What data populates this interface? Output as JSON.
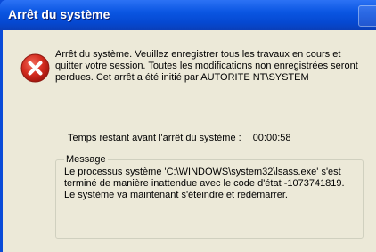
{
  "window": {
    "title": "Arrêt du système"
  },
  "dialog": {
    "icon": "error-icon",
    "message": "Arrêt du système. Veuillez enregistrer tous les travaux en cours et quitter votre session. Toutes les modifications non enregistrées seront perdues. Cet arrêt a été initié par AUTORITE NT\\SYSTEM",
    "countdown_label": "Temps restant avant l'arrêt du système :",
    "countdown_value": "00:00:58",
    "group_title": "Message",
    "group_text": "Le processus système 'C:\\WINDOWS\\system32\\lsass.exe' s'est terminé de manière inattendue avec le code d'état -1073741819. Le système va maintenant s'éteindre et redémarrer."
  },
  "colors": {
    "titlebar": "#0A56E2",
    "client": "#ECE9D8",
    "error_red": "#D22B1E"
  }
}
